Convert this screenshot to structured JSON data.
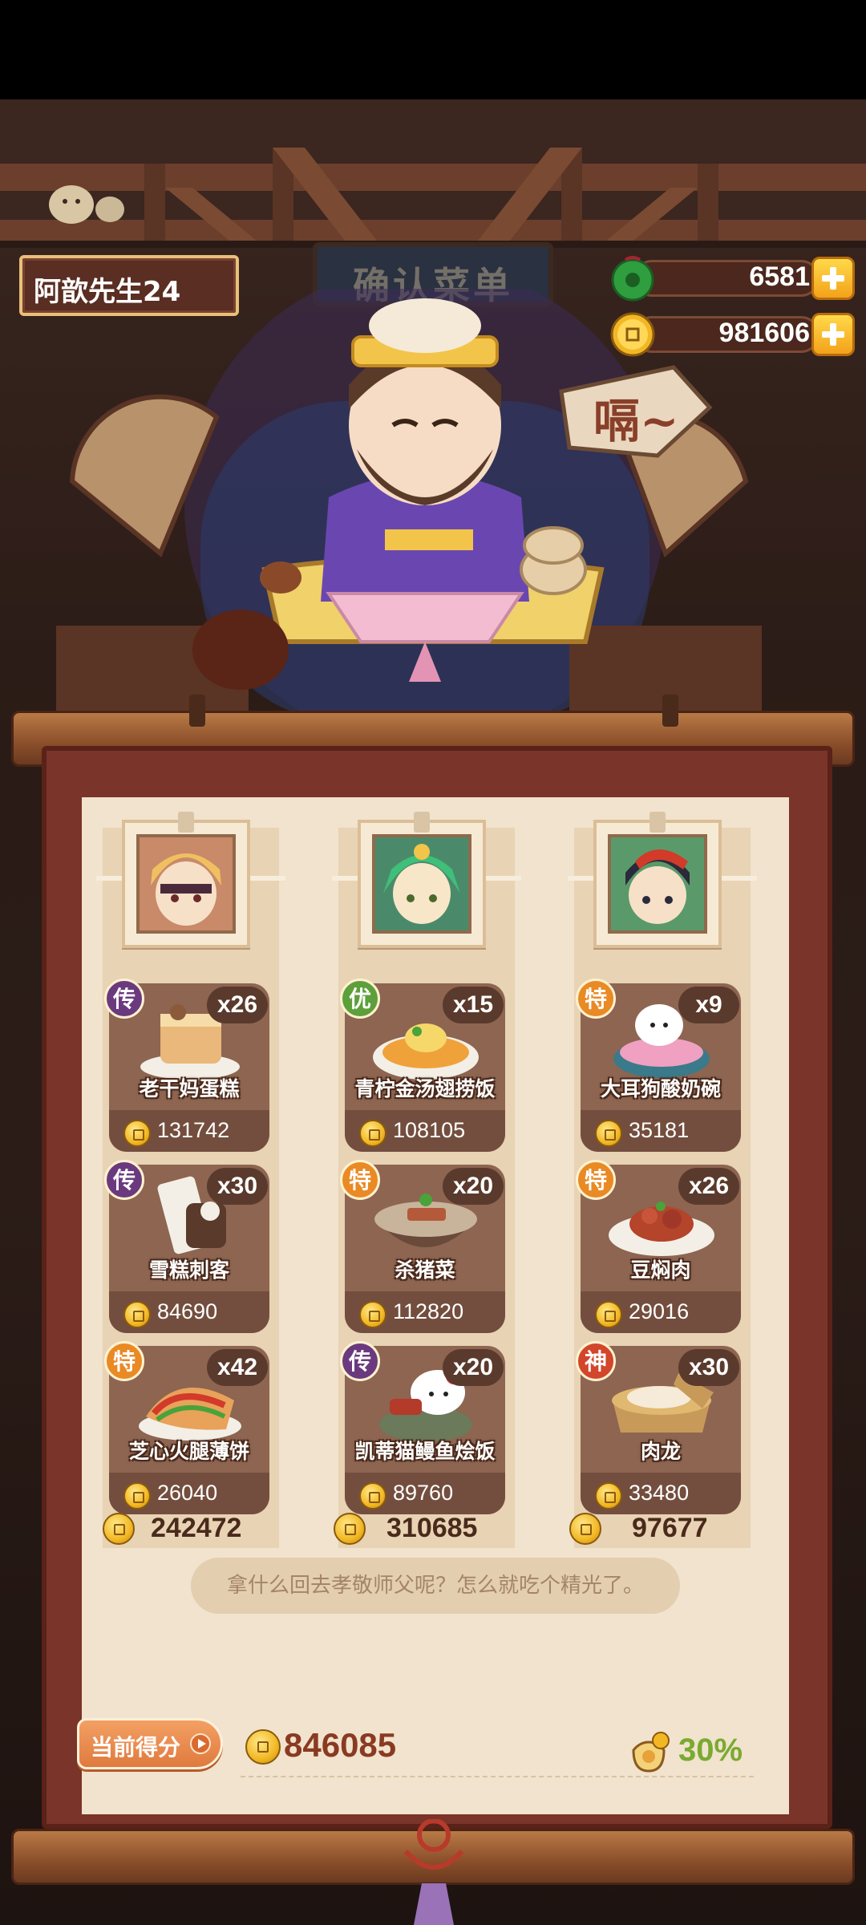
{
  "player": {
    "name": "阿歆先生24"
  },
  "sign": {
    "text": "确认菜单"
  },
  "currency": {
    "jade": {
      "value": "6581",
      "icon": "jade-icon"
    },
    "coins": {
      "value": "981606",
      "icon": "coin-icon"
    }
  },
  "speech": {
    "text": "嗝~"
  },
  "colors": {
    "legend": "#6b3a7e",
    "excellent": "#5d9f3a",
    "special": "#e98a25",
    "god": "#d2462c",
    "bonus": "#7aaa32"
  },
  "columns": [
    {
      "portrait": "blonde-chef-portrait",
      "dishes": [
        {
          "grade": "传",
          "qty": "x26",
          "name": "老干妈蛋糕",
          "price": "131742"
        },
        {
          "grade": "传",
          "qty": "x30",
          "name": "雪糕刺客",
          "price": "84690"
        },
        {
          "grade": "特",
          "qty": "x42",
          "name": "芝心火腿薄饼",
          "price": "26040"
        }
      ],
      "total": "242472"
    },
    {
      "portrait": "green-hair-chef-portrait",
      "dishes": [
        {
          "grade": "优",
          "qty": "x15",
          "name": "青柠金汤翅捞饭",
          "price": "108105"
        },
        {
          "grade": "特",
          "qty": "x20",
          "name": "杀猪菜",
          "price": "112820"
        },
        {
          "grade": "传",
          "qty": "x20",
          "name": "凯蒂猫鳗鱼烩饭",
          "price": "89760"
        }
      ],
      "total": "310685"
    },
    {
      "portrait": "red-hat-chef-portrait",
      "dishes": [
        {
          "grade": "特",
          "qty": "x9",
          "name": "大耳狗酸奶碗",
          "price": "35181"
        },
        {
          "grade": "特",
          "qty": "x26",
          "name": "豆焖肉",
          "price": "29016"
        },
        {
          "grade": "神",
          "qty": "x30",
          "name": "肉龙",
          "price": "33480"
        }
      ],
      "total": "97677"
    }
  ],
  "quote": "拿什么回去孝敬师父呢？怎么就吃个精光了。",
  "score": {
    "label": "当前得分",
    "value": "846085",
    "bonus": "30%"
  }
}
